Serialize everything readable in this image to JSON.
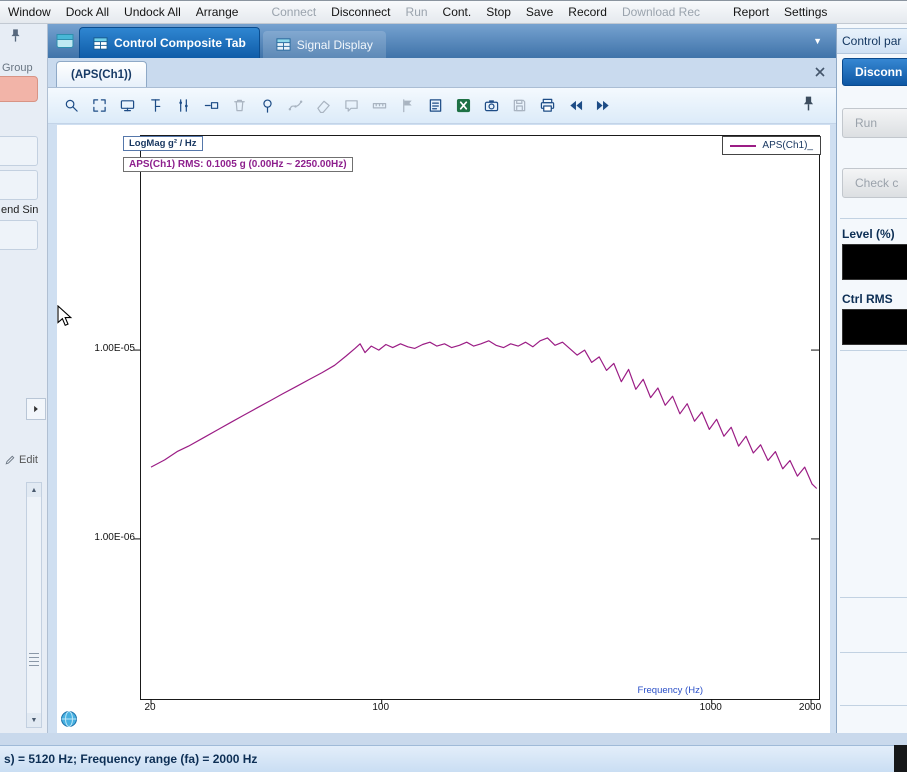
{
  "menu": {
    "items": [
      {
        "label": "Window",
        "enabled": true
      },
      {
        "label": "Dock All",
        "enabled": true
      },
      {
        "label": "Undock All",
        "enabled": true
      },
      {
        "label": "Arrange",
        "enabled": true
      },
      {
        "label": "Connect",
        "enabled": false,
        "gap_before": true
      },
      {
        "label": "Disconnect",
        "enabled": true
      },
      {
        "label": "Run",
        "enabled": false
      },
      {
        "label": "Cont.",
        "enabled": true
      },
      {
        "label": "Stop",
        "enabled": true
      },
      {
        "label": "Save",
        "enabled": true
      },
      {
        "label": "Record",
        "enabled": true
      },
      {
        "label": "Download Rec",
        "enabled": false
      },
      {
        "label": "Report",
        "enabled": true,
        "gap_before": true
      },
      {
        "label": "Settings",
        "enabled": true
      }
    ]
  },
  "tab_strip": {
    "tabs": [
      {
        "label": "Control Composite Tab",
        "active": true
      },
      {
        "label": "Signal Display",
        "active": false
      }
    ]
  },
  "doc_tab": {
    "label": "(APS(Ch1))"
  },
  "sidebar": {
    "group_label": "Group",
    "swept_label": "end Sin",
    "edit_label": "Edit"
  },
  "toolbar": {
    "icons": [
      {
        "name": "auto-scale",
        "enabled": true
      },
      {
        "name": "expand",
        "enabled": true
      },
      {
        "name": "display-setting",
        "enabled": true
      },
      {
        "name": "cursor",
        "enabled": true
      },
      {
        "name": "harmonic-cursor",
        "enabled": true
      },
      {
        "name": "remove-marker",
        "enabled": true
      },
      {
        "name": "delete-marker",
        "enabled": false
      },
      {
        "name": "peak-marker",
        "enabled": true
      },
      {
        "name": "curve-fit",
        "enabled": false
      },
      {
        "name": "erase",
        "enabled": false
      },
      {
        "name": "annotation",
        "enabled": false
      },
      {
        "name": "measure",
        "enabled": false
      },
      {
        "name": "flag-marker",
        "enabled": false
      },
      {
        "name": "note",
        "enabled": true
      },
      {
        "name": "export-excel",
        "enabled": true
      },
      {
        "name": "snapshot",
        "enabled": true
      },
      {
        "name": "save-signal",
        "enabled": false
      },
      {
        "name": "print",
        "enabled": true
      },
      {
        "name": "prev-frame",
        "enabled": true
      },
      {
        "name": "next-frame",
        "enabled": true
      }
    ]
  },
  "right_panel": {
    "title": "Control par",
    "buttons": [
      {
        "label": "Disconn",
        "enabled": true
      },
      {
        "label": "Run",
        "enabled": false
      },
      {
        "label": "Check c",
        "enabled": false
      }
    ],
    "fields": [
      {
        "label": "Level (%)"
      },
      {
        "label": "Ctrl RMS"
      }
    ]
  },
  "status_bar": {
    "text": "s) = 5120 Hz; Frequency range (fa) = 2000 Hz"
  },
  "colors": {
    "accent": "#0f5ca8",
    "curve": "#9b1d85"
  },
  "chart_data": {
    "type": "line",
    "title": "APS(Ch1)",
    "value_format_label": "LogMag g² / Hz",
    "rms_label": "APS(Ch1) RMS: 0.1005 g (0.00Hz ~ 2250.00Hz)",
    "legend": [
      {
        "name": "APS(Ch1)_",
        "color": "#9b1d85"
      }
    ],
    "legend_position": "top-right",
    "grid": false,
    "x_axis": {
      "label": "Frequency (Hz)",
      "scale": "log",
      "range": [
        18.65,
        2114
      ],
      "ticks": [
        20,
        100,
        1000,
        2000
      ],
      "tick_labels": [
        "20",
        "100",
        "1000",
        "2000"
      ]
    },
    "y_axis": {
      "label": "g²/Hz",
      "scale": "log",
      "range": [
        1.42e-07,
        0.000136
      ],
      "ticks": [
        1e-05,
        1e-06
      ],
      "tick_labels": [
        "1.00E-05",
        "1.00E-06"
      ]
    },
    "series": [
      {
        "name": "APS(Ch1)",
        "color": "#9b1d85",
        "points": [
          [
            20,
            2.4e-06
          ],
          [
            22,
            2.62e-06
          ],
          [
            24,
            2.9e-06
          ],
          [
            26,
            3.1e-06
          ],
          [
            29,
            3.45e-06
          ],
          [
            32,
            3.8e-06
          ],
          [
            35,
            4.15e-06
          ],
          [
            38,
            4.5e-06
          ],
          [
            42,
            4.95e-06
          ],
          [
            46,
            5.4e-06
          ],
          [
            50,
            5.85e-06
          ],
          [
            55,
            6.4e-06
          ],
          [
            60,
            6.95e-06
          ],
          [
            66,
            7.6e-06
          ],
          [
            72,
            8.3e-06
          ],
          [
            78,
            9.3e-06
          ],
          [
            83,
            1.02e-05
          ],
          [
            86,
            1.08e-05
          ],
          [
            89,
            9.7e-06
          ],
          [
            93,
            1.05e-05
          ],
          [
            98,
            1e-05
          ],
          [
            103,
            1.07e-05
          ],
          [
            108,
            1.03e-05
          ],
          [
            114,
            1.08e-05
          ],
          [
            120,
            1.04e-05
          ],
          [
            126,
            1.02e-05
          ],
          [
            133,
            1.07e-05
          ],
          [
            140,
            1.1e-05
          ],
          [
            147,
            1.05e-05
          ],
          [
            155,
            1.08e-05
          ],
          [
            163,
            1.03e-05
          ],
          [
            172,
            1.06e-05
          ],
          [
            181,
            1.1e-05
          ],
          [
            190,
            1.05e-05
          ],
          [
            200,
            1.08e-05
          ],
          [
            211,
            1.12e-05
          ],
          [
            222,
            1.06e-05
          ],
          [
            234,
            1.03e-05
          ],
          [
            246,
            1.08e-05
          ],
          [
            259,
            1.05e-05
          ],
          [
            273,
            1.1e-05
          ],
          [
            287,
            1.04e-05
          ],
          [
            302,
            1.12e-05
          ],
          [
            318,
            1.16e-05
          ],
          [
            335,
            1.06e-05
          ],
          [
            353,
            1.1e-05
          ],
          [
            371,
            1.02e-05
          ],
          [
            391,
            9.4e-06
          ],
          [
            412,
            1e-05
          ],
          [
            433,
            8.6e-06
          ],
          [
            456,
            9.2e-06
          ],
          [
            480,
            7.8e-06
          ],
          [
            505,
            8.5e-06
          ],
          [
            532,
            6.8e-06
          ],
          [
            560,
            7.9e-06
          ],
          [
            589,
            6.2e-06
          ],
          [
            620,
            7e-06
          ],
          [
            653,
            5.6e-06
          ],
          [
            687,
            6.3e-06
          ],
          [
            723,
            5.1e-06
          ],
          [
            761,
            5.7e-06
          ],
          [
            801,
            4.6e-06
          ],
          [
            843,
            5.2e-06
          ],
          [
            887,
            4.2e-06
          ],
          [
            934,
            4.7e-06
          ],
          [
            983,
            3.8e-06
          ],
          [
            1035,
            4.3e-06
          ],
          [
            1089,
            3.5e-06
          ],
          [
            1146,
            3.9e-06
          ],
          [
            1206,
            3.1e-06
          ],
          [
            1270,
            3.5e-06
          ],
          [
            1337,
            2.85e-06
          ],
          [
            1407,
            3.15e-06
          ],
          [
            1481,
            2.6e-06
          ],
          [
            1559,
            2.9e-06
          ],
          [
            1641,
            2.35e-06
          ],
          [
            1727,
            2.6e-06
          ],
          [
            1818,
            2.15e-06
          ],
          [
            1913,
            2.4e-06
          ],
          [
            2014,
            1.95e-06
          ],
          [
            2080,
            1.85e-06
          ]
        ]
      }
    ]
  }
}
